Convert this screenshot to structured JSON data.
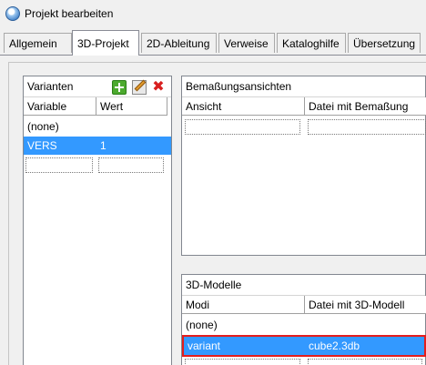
{
  "window": {
    "title": "Projekt bearbeiten"
  },
  "tabs": [
    {
      "label": "Allgemein"
    },
    {
      "label": "3D-Projekt"
    },
    {
      "label": "2D-Ableitung"
    },
    {
      "label": "Verweise"
    },
    {
      "label": "Kataloghilfe"
    },
    {
      "label": "Übersetzung"
    }
  ],
  "variants": {
    "title": "Varianten",
    "columns": [
      "Variable",
      "Wert"
    ],
    "rows": [
      {
        "variable": "(none)",
        "wert": ""
      },
      {
        "variable": "VERS",
        "wert": "1"
      }
    ],
    "icons": [
      "add-table-icon",
      "edit-icon",
      "delete-icon"
    ],
    "selected_color": "#3399ff"
  },
  "dimension_views": {
    "title": "Bemaßungsansichten",
    "columns": [
      "Ansicht",
      "Datei mit Bemaßung"
    ]
  },
  "models": {
    "title": "3D-Modelle",
    "columns": [
      "Modi",
      "Datei mit 3D-Modell"
    ],
    "rows": [
      {
        "modi": "(none)",
        "file": ""
      },
      {
        "modi": "variant",
        "file": "cube2.3db"
      }
    ],
    "highlight_color": "#e41d1d"
  }
}
